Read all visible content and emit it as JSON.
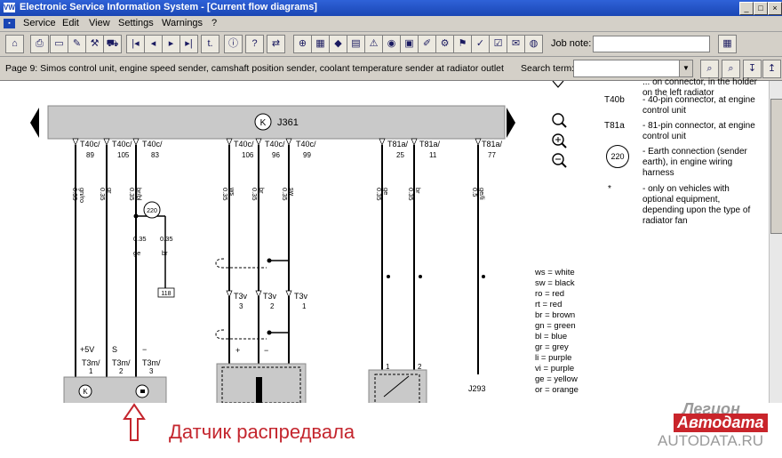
{
  "window": {
    "title": "Electronic Service Information System - [Current flow diagrams]"
  },
  "menu": [
    "Service",
    "Edit",
    "View",
    "Settings",
    "Warnings",
    "?"
  ],
  "toolbar": {
    "jobnote_label": "Job note:",
    "jobnote_value": ""
  },
  "pagebar": {
    "title": "Page 9: Simos control unit, engine speed sender, camshaft position sender, coolant temperature sender at radiator outlet",
    "search_label": "Search term:",
    "search_value": ""
  },
  "diagram": {
    "unit_label": "J361",
    "unit_symbol": "K",
    "connectors": [
      {
        "code": "T40c/",
        "pin": "89",
        "wire_size": "0.35",
        "wire_color": "gn/ro"
      },
      {
        "code": "T40c/",
        "pin": "105",
        "wire_size": "0.35",
        "wire_color": "gr"
      },
      {
        "code": "T40c/",
        "pin": "83",
        "wire_size": "0.35",
        "wire_color": "br/bl"
      },
      {
        "code": "T40c/",
        "pin": "106",
        "wire_size": "0.35",
        "wire_color": "ws"
      },
      {
        "code": "T40c/",
        "pin": "96",
        "wire_size": "0.35",
        "wire_color": "br"
      },
      {
        "code": "T40c/",
        "pin": "99",
        "wire_size": "0.35",
        "wire_color": "sw"
      },
      {
        "code": "T81a/",
        "pin": "25",
        "wire_size": "0.35",
        "wire_color": "ge"
      },
      {
        "code": "T81a/",
        "pin": "11",
        "wire_size": "0.35",
        "wire_color": "br"
      },
      {
        "code": "T81a/",
        "pin": "77",
        "wire_size": "0.5",
        "wire_color": "ge/li"
      }
    ],
    "earth_label": "220",
    "branch_wires": [
      {
        "size": "0.35",
        "color": "ge"
      },
      {
        "size": "0.35",
        "color": "br"
      }
    ],
    "ref_box": "118",
    "t3v": [
      {
        "code": "T3v",
        "pin": "3"
      },
      {
        "code": "T3v",
        "pin": "2"
      },
      {
        "code": "T3v",
        "pin": "1"
      }
    ],
    "t3m": [
      {
        "sign": "+5V",
        "code": "T3m/",
        "pin": "1"
      },
      {
        "sign": "S",
        "code": "T3m/",
        "pin": "2"
      },
      {
        "sign": "−",
        "code": "T3m/",
        "pin": "3"
      }
    ],
    "sender_pins": [
      "1",
      "2"
    ],
    "j293": "J293",
    "mid_signs": [
      "+",
      "−"
    ],
    "bottom_symbol": "K"
  },
  "legend": [
    {
      "code": "ws",
      "name": "white"
    },
    {
      "code": "sw",
      "name": "black"
    },
    {
      "code": "ro",
      "name": "red"
    },
    {
      "code": "rt",
      "name": "red"
    },
    {
      "code": "br",
      "name": "brown"
    },
    {
      "code": "gn",
      "name": "green"
    },
    {
      "code": "bl",
      "name": "blue"
    },
    {
      "code": "gr",
      "name": "grey"
    },
    {
      "code": "li",
      "name": "purple"
    },
    {
      "code": "vi",
      "name": "purple"
    },
    {
      "code": "ge",
      "name": "yellow"
    },
    {
      "code": "or",
      "name": "orange"
    }
  ],
  "notes": {
    "top_partial": "... on connector, in the holder on the left radiator",
    "items": [
      {
        "code": "T40b",
        "text": "- 40-pin connector, at engine control unit"
      },
      {
        "code": "T81a",
        "text": "- 81-pin connector, at engine control unit"
      },
      {
        "code": "220",
        "text": "- Earth connection (sender earth), in engine wiring harness"
      },
      {
        "code": "*",
        "text": "- only on vehicles with optional equipment, depending upon the type of radiator fan"
      }
    ]
  },
  "annotation": {
    "text": "Датчик распредвала",
    "color": "#c4262e"
  },
  "watermark": {
    "line1": "Легион",
    "line2": "Автодата",
    "line3": "AUTODATA.RU"
  }
}
